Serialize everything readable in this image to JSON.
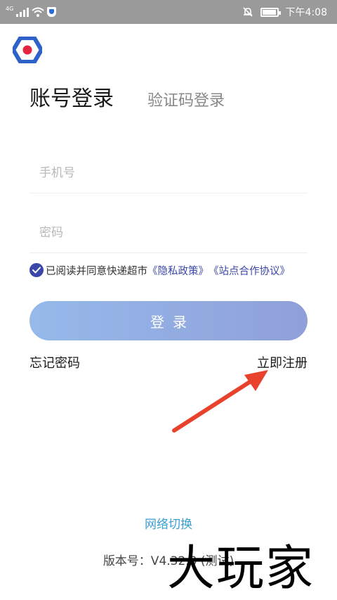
{
  "status_bar": {
    "network_type": "4G",
    "time": "下午4:08"
  },
  "tabs": {
    "account_login": "账号登录",
    "sms_login": "验证码登录"
  },
  "form": {
    "phone_placeholder": "手机号",
    "password_placeholder": "密码",
    "phone_value": "",
    "password_value": ""
  },
  "agreement": {
    "checked": true,
    "prefix": "已阅读并同意快递超市",
    "privacy_link": "《隐私政策》",
    "partner_link": "《站点合作协议》"
  },
  "login_button": "登录",
  "forgot_password": "忘记密码",
  "register": "立即注册",
  "network_switch": "网络切换",
  "version": "版本号：V4.32.0 (测试)",
  "watermark": "大玩家",
  "colors": {
    "accent": "#3b47a8",
    "button_start": "#96b9ea",
    "button_end": "#8fa0d8",
    "link_blue": "#3a9fd6",
    "arrow_red": "#e8412c",
    "status_bar": "#9a9a9a"
  },
  "icons": {
    "logo": "app-logo-icon",
    "checkbox": "check-circle-icon",
    "arrow": "red-arrow-annotation"
  }
}
